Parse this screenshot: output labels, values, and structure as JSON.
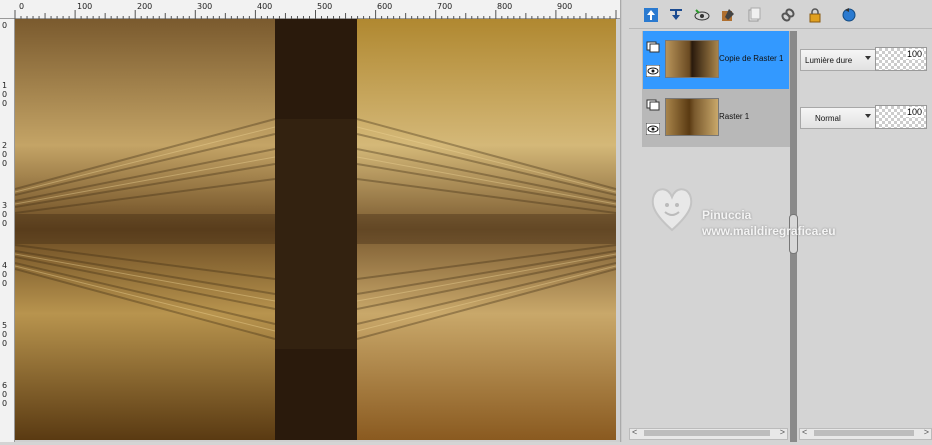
{
  "ruler": {
    "h_labels": [
      "0",
      "100",
      "200",
      "300",
      "400",
      "500",
      "600",
      "700",
      "800",
      "900"
    ],
    "v_labels": [
      [
        "0"
      ],
      [
        "1",
        "0",
        "0"
      ],
      [
        "2",
        "0",
        "0"
      ],
      [
        "3",
        "0",
        "0"
      ],
      [
        "4",
        "0",
        "0"
      ],
      [
        "5",
        "0",
        "0"
      ],
      [
        "6",
        "0",
        "0"
      ]
    ]
  },
  "toolbar": {
    "icons": [
      "move-layer-up-icon",
      "move-layer-down-icon",
      "visibility-icon",
      "edit-icon",
      "copy-icon",
      "link-icon",
      "lock-icon",
      "refresh-icon"
    ]
  },
  "layers": [
    {
      "name": "Copie de Raster 1",
      "blend": "Lumière dure",
      "opacity": "100",
      "selected": true
    },
    {
      "name": "Raster 1",
      "blend": "Normal",
      "opacity": "100",
      "selected": false
    }
  ],
  "watermark": {
    "line1": "Pinuccia",
    "line2": "www.maildiregrafica.eu"
  },
  "colors": {
    "selection": "#3399ff",
    "canvas_dark": "#2a1a0c",
    "canvas_light": "#c9a86a"
  }
}
